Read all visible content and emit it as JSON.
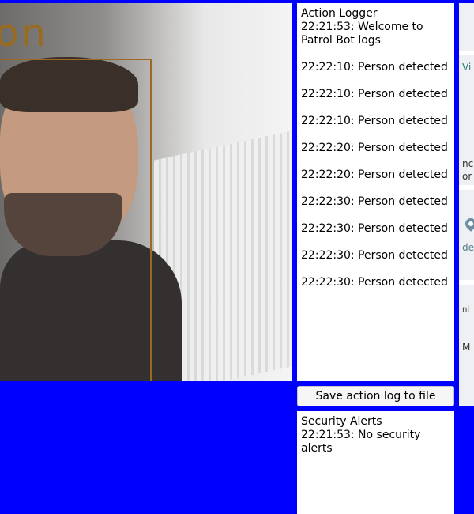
{
  "camera": {
    "detection_label": "on"
  },
  "logger": {
    "title": "Action Logger",
    "entries": [
      "22:21:53: Welcome to Patrol Bot logs",
      "22:22:10: Person detected",
      "22:22:10: Person detected",
      "22:22:10: Person detected",
      "22:22:20: Person detected",
      "22:22:20: Person detected",
      "22:22:30: Person detected",
      "22:22:30: Person detected",
      "22:22:30: Person detected",
      "22:22:30: Person detected"
    ]
  },
  "save_button": {
    "label": "Save action log to file"
  },
  "alerts": {
    "title": "Security Alerts",
    "entries": [
      "22:21:53: No security alerts"
    ]
  },
  "map": {
    "labels": [
      "Vi",
      "nc",
      "or",
      "de",
      "ni",
      "M"
    ]
  },
  "colors": {
    "background": "#0000ff",
    "detection_box": "#9a6b1d"
  }
}
